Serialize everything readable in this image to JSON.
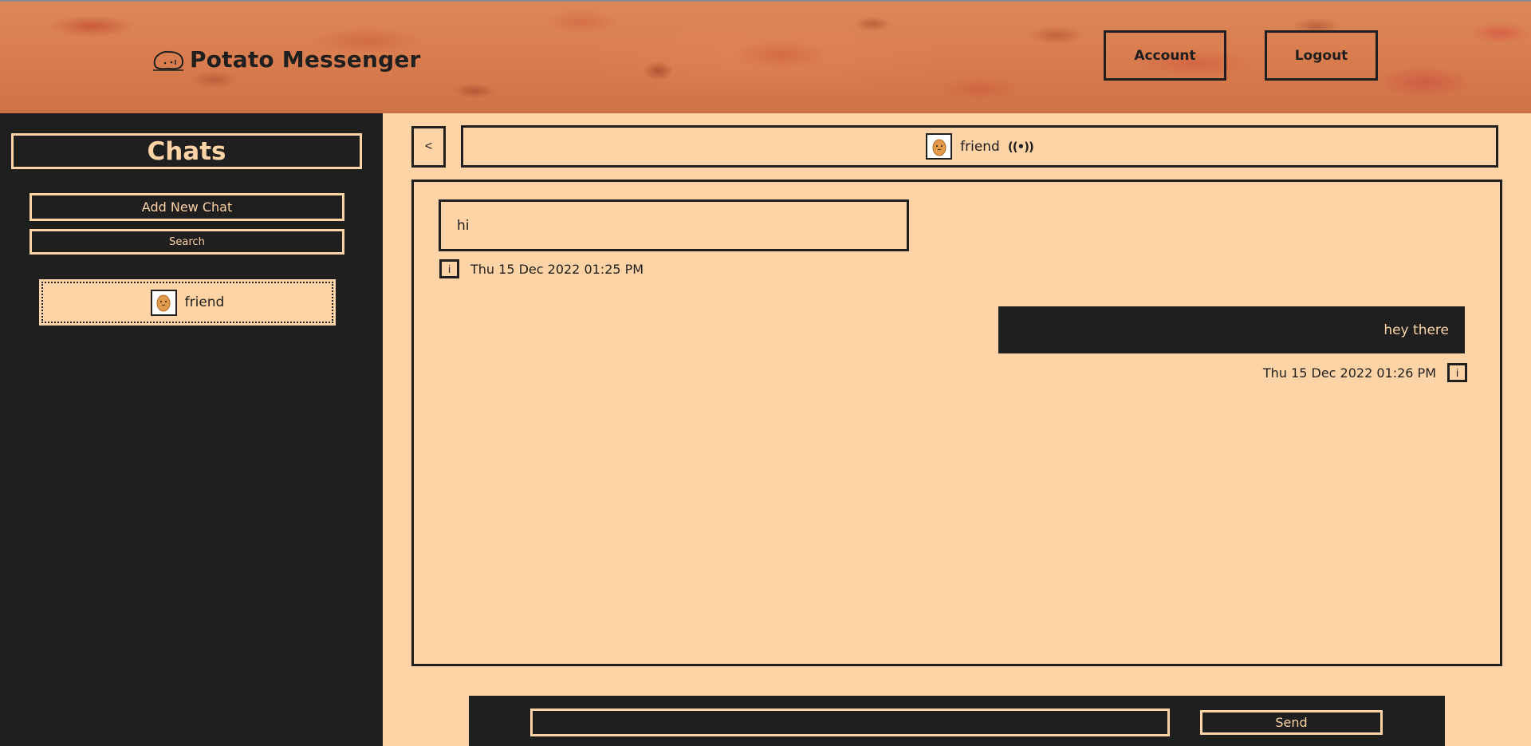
{
  "header": {
    "app_title": "Potato Messenger",
    "logo_icon": "potato-logo-icon",
    "account_label": "Account",
    "logout_label": "Logout"
  },
  "sidebar": {
    "title": "Chats",
    "add_chat_label": "Add New Chat",
    "search_label": "Search",
    "chats": [
      {
        "name": "friend",
        "avatar_icon": "potato-avatar-icon"
      }
    ]
  },
  "chat": {
    "back_label": "<",
    "contact_name": "friend",
    "status_icon": "online-broadcast-icon",
    "status_glyph": "((•))",
    "messages": [
      {
        "direction": "received",
        "text": "hi",
        "timestamp": "Thu 15 Dec 2022 01:25 PM",
        "info_label": "i"
      },
      {
        "direction": "sent",
        "text": "hey there",
        "timestamp": "Thu 15 Dec 2022 01:26 PM",
        "info_label": "i"
      }
    ]
  },
  "composer": {
    "input_value": "",
    "input_placeholder": "",
    "send_label": "Send"
  },
  "colors": {
    "dark": "#1f1f1f",
    "peach": "#fed3a6",
    "header_orange": "#d97d4f",
    "potato": "#e39a4a"
  }
}
